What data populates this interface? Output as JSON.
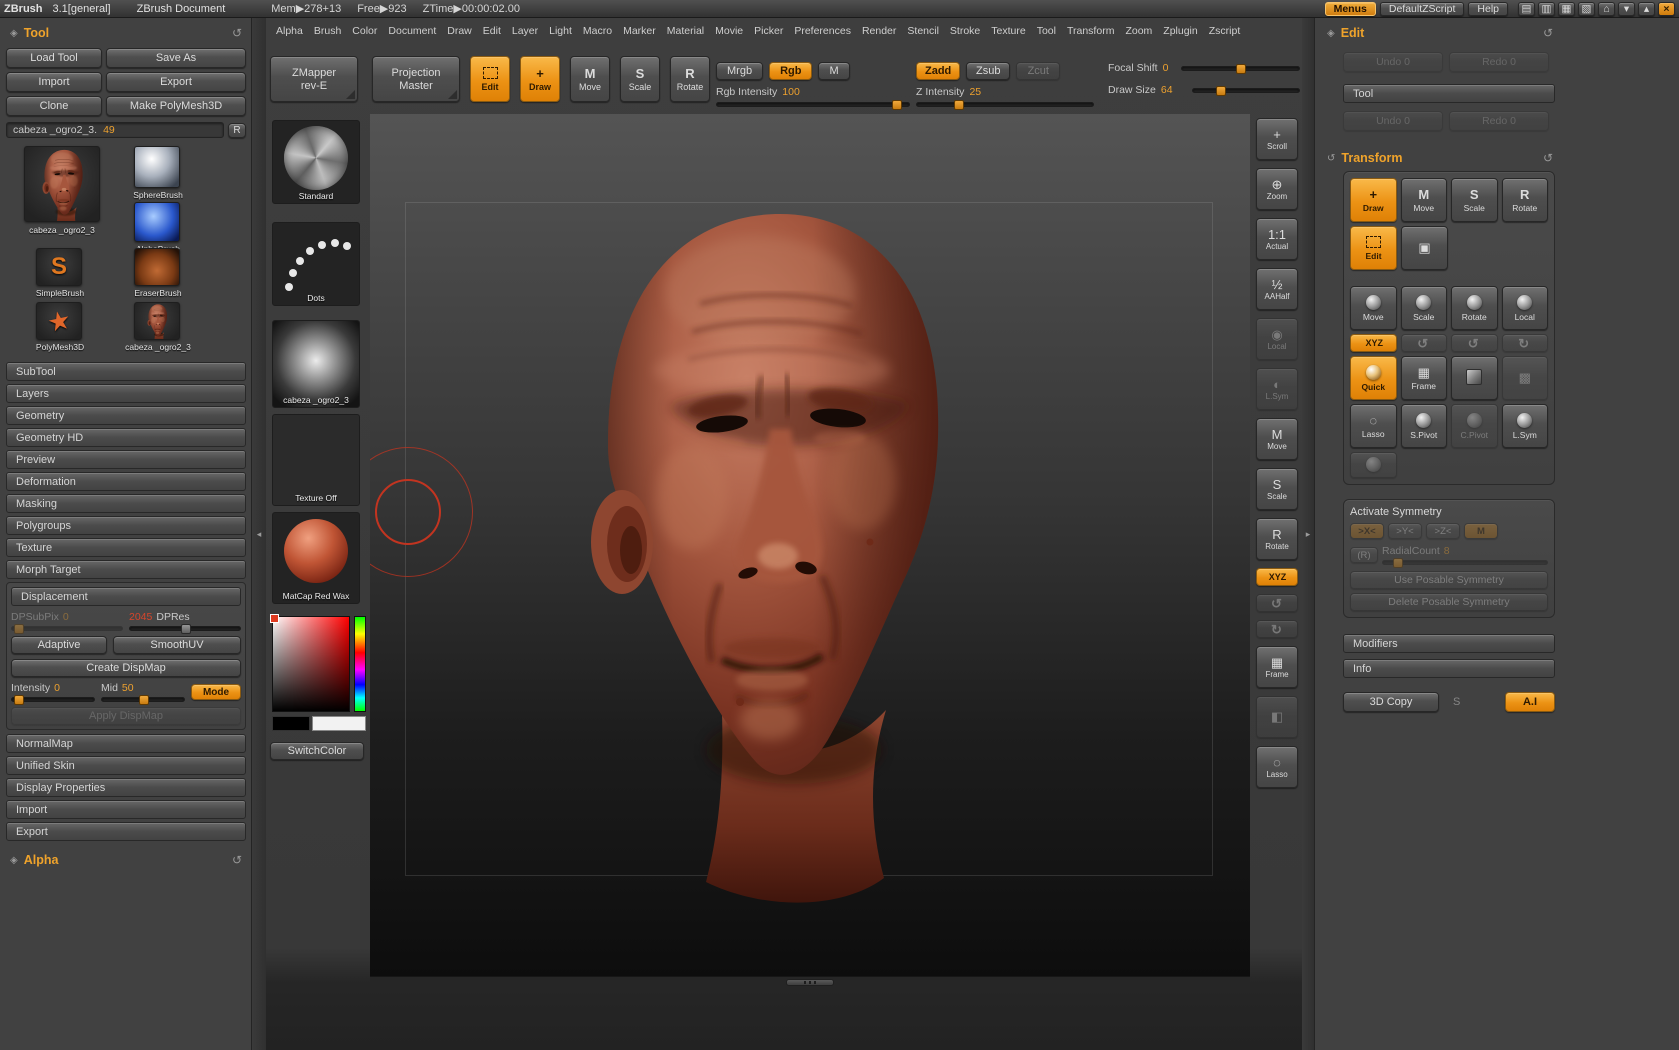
{
  "colors": {
    "accent_orange": "#ee9e2c",
    "cursor_red": "#c23420",
    "material_red": "#a2543d"
  },
  "titlebar": {
    "app_name": "ZBrush",
    "version": "3.1[general]",
    "document_title": "ZBrush Document",
    "stats": {
      "mem": "Mem▶278+13",
      "free": "Free▶923",
      "ztime": "ZTime▶00:00:02.00"
    },
    "menus_button": "Menus",
    "zscript_button": "DefaultZScript",
    "help_button": "Help",
    "window_icons": [
      {
        "icon": "knob-tray-icon",
        "glyph": "▤"
      },
      {
        "icon": "knob2-tray-icon",
        "glyph": "▥"
      },
      {
        "icon": "doc-grid-icon",
        "glyph": "▦"
      },
      {
        "icon": "doc-grid2-icon",
        "glyph": "▧"
      },
      {
        "icon": "home-icon",
        "glyph": "⌂"
      },
      {
        "icon": "minimize-icon",
        "glyph": "▾"
      },
      {
        "icon": "restore-icon",
        "glyph": "▴"
      },
      {
        "icon": "close-icon",
        "glyph": "×",
        "accent": true
      }
    ]
  },
  "menubar": {
    "items": [
      "Alpha",
      "Brush",
      "Color",
      "Document",
      "Draw",
      "Edit",
      "Layer",
      "Light",
      "Macro",
      "Marker",
      "Material",
      "Movie",
      "Picker",
      "Preferences",
      "Render",
      "Stencil",
      "Stroke",
      "Texture",
      "Tool",
      "Transform",
      "Zoom",
      "Zplugin",
      "Zscript"
    ]
  },
  "tool_panel": {
    "title": "Tool",
    "action_buttons": [
      {
        "label": "Load Tool"
      },
      {
        "label": "Save As"
      },
      {
        "label": "Import"
      },
      {
        "label": "Export"
      },
      {
        "label": "Clone"
      },
      {
        "label": "Make PolyMesh3D"
      }
    ],
    "current_tool": {
      "name": "cabeza _ogro2_3.",
      "index": "49",
      "r_button": "R"
    },
    "thumbnails": [
      {
        "label": "cabeza _ogro2_3",
        "kind": "head-large"
      },
      {
        "label": "SphereBrush",
        "kind": "sphere"
      },
      {
        "label": "AlphaBrush",
        "kind": "alpha-brush"
      },
      {
        "label": "SimpleBrush",
        "kind": "simple-brush"
      },
      {
        "label": "EraserBrush",
        "kind": "eraser-brush"
      },
      {
        "label": "PolyMesh3D",
        "kind": "polymesh-star"
      },
      {
        "label": "cabeza _ogro2_3",
        "kind": "head-small"
      }
    ],
    "sections_top": [
      "SubTool",
      "Layers",
      "Geometry",
      "Geometry HD",
      "Preview",
      "Deformation",
      "Masking",
      "Polygroups",
      "Texture",
      "Morph Target"
    ],
    "displacement": {
      "title": "Displacement",
      "dpsubpix": {
        "label": "DPSubPix",
        "value": "0",
        "handle_style": "left:2%"
      },
      "dpres": {
        "value": "2045",
        "label": "DPRes",
        "handle_style": "left:46%"
      },
      "adaptive_button": "Adaptive",
      "smoothuv_button": "SmoothUV",
      "create_dispmap_button": "Create DispMap",
      "intensity": {
        "label": "Intensity",
        "value": "0",
        "handle_style": "left:2%"
      },
      "mid": {
        "label": "Mid",
        "value": "50",
        "handle_style": "left:45%"
      },
      "mode_button": "Mode",
      "apply_dispmap_button": "Apply DispMap"
    },
    "sections_bottom": [
      "NormalMap",
      "Unified Skin",
      "Display Properties",
      "Import",
      "Export"
    ],
    "alpha_title": "Alpha"
  },
  "toolbar": {
    "zmapper_button": {
      "line1": "ZMapper",
      "line2": "rev-E"
    },
    "projection_master_button": {
      "line1": "Projection",
      "line2": "Master"
    },
    "edit_modes": [
      {
        "label": "Edit",
        "kind": "edit",
        "icon": "edit-frame-icon",
        "active": true
      },
      {
        "label": "Draw",
        "glyph": "+",
        "icon": "draw-crosshair-icon",
        "active": true
      },
      {
        "label": "Move",
        "glyph": "M",
        "icon": "move-icon"
      },
      {
        "label": "Scale",
        "glyph": "S",
        "icon": "scale-icon"
      },
      {
        "label": "Rotate",
        "glyph": "R",
        "icon": "rotate-icon"
      }
    ],
    "color_modes": [
      {
        "label": "Mrgb"
      },
      {
        "label": "Rgb",
        "active": true
      },
      {
        "label": "M"
      }
    ],
    "rgb_intensity": {
      "label": "Rgb Intensity",
      "value": "100",
      "handle_style": "left:91%"
    },
    "depth_modes": [
      {
        "label": "Zadd",
        "active": true
      },
      {
        "label": "Zsub"
      },
      {
        "label": "Zcut",
        "dim": true
      }
    ],
    "z_intensity": {
      "label": "Z Intensity",
      "value": "25",
      "handle_style": "left:21%"
    },
    "focal_shift": {
      "label": "Focal Shift",
      "value": "0",
      "handle_style": "left:46%"
    },
    "draw_size": {
      "label": "Draw Size",
      "value": "64",
      "handle_style": "left:22%"
    }
  },
  "brush_palette": {
    "brush": {
      "label": "Standard"
    },
    "stroke": {
      "label": "Dots"
    },
    "alpha": {
      "label": "cabeza _ogro2_3"
    },
    "texture": {
      "label": "Texture Off"
    },
    "material": {
      "label": "MatCap Red Wax"
    },
    "switch_color_button": "SwitchColor"
  },
  "right_shelf": {
    "items": [
      {
        "label": "Scroll",
        "icon": "scroll-icon",
        "glyph": "+"
      },
      {
        "label": "Zoom",
        "icon": "zoom-icon",
        "glyph": "⊕"
      },
      {
        "label": "Actual",
        "icon": "actual-size-icon",
        "glyph": "1:1"
      },
      {
        "label": "AAHalf",
        "icon": "aa-half-icon",
        "glyph": "½"
      },
      {
        "label": "Local",
        "icon": "local-pivot-icon",
        "glyph": "◉",
        "dim": true
      },
      {
        "label": "L.Sym",
        "icon": "local-symmetry-icon",
        "glyph": "◐",
        "dim": true
      },
      {
        "label": "Move",
        "icon": "move-icon",
        "glyph": "M"
      },
      {
        "label": "Scale",
        "icon": "scale-icon",
        "glyph": "S"
      },
      {
        "label": "Rotate",
        "icon": "rotate-icon",
        "glyph": "R"
      },
      {
        "label": "XYZ",
        "icon": "xyz-axis-icon",
        "active": true,
        "small": true
      },
      {
        "label": "",
        "icon": "spin-ccw-icon",
        "glyph": "↺",
        "dim": true,
        "small": true
      },
      {
        "label": "",
        "icon": "spin-cw-icon",
        "glyph": "↻",
        "dim": true,
        "small": true
      },
      {
        "label": "Frame",
        "icon": "frame-icon",
        "glyph": "▦"
      },
      {
        "label": "",
        "icon": "paint-icon",
        "glyph": "◧",
        "dim": true
      },
      {
        "label": "Lasso",
        "icon": "lasso-icon",
        "glyph": "◌"
      }
    ]
  },
  "edit_panel": {
    "title": "Edit",
    "document_history": [
      {
        "label": "Undo 0",
        "dim": true
      },
      {
        "label": "Redo 0",
        "dim": true
      }
    ],
    "tool_section_title": "Tool",
    "tool_history": [
      {
        "label": "Undo 0",
        "dim": true
      },
      {
        "label": "Redo 0",
        "dim": true
      }
    ],
    "transform": {
      "title": "Transform",
      "row_modes": [
        {
          "label": "Draw",
          "glyph": "+",
          "icon": "draw-crosshair-icon",
          "active": true
        },
        {
          "label": "Move",
          "glyph": "M",
          "icon": "move-icon"
        },
        {
          "label": "Scale",
          "glyph": "S",
          "icon": "scale-icon"
        },
        {
          "label": "Rotate",
          "glyph": "R",
          "icon": "rotate-icon"
        }
      ],
      "row_edit": [
        {
          "label": "Edit",
          "kind": "edit",
          "icon": "edit-frame-icon",
          "active": true
        },
        {
          "label": "",
          "glyph": "▣",
          "icon": "snapshot-icon"
        }
      ],
      "row_gizmo": [
        {
          "label": "Move",
          "kind": "ball",
          "icon": "move-gizmo-icon"
        },
        {
          "label": "Scale",
          "kind": "ball",
          "icon": "scale-gizmo-icon"
        },
        {
          "label": "Rotate",
          "kind": "ball",
          "icon": "rotate-gizmo-icon"
        },
        {
          "label": "Local",
          "kind": "ball",
          "icon": "local-gizmo-icon"
        }
      ],
      "row_axis": [
        {
          "label": "XYZ",
          "active": true,
          "small": true,
          "icon": "xyz-axis-icon"
        },
        {
          "label": "",
          "glyph": "↺",
          "dim": true,
          "small": true,
          "icon": "rotate-x-icon"
        },
        {
          "label": "",
          "glyph": "↺",
          "dim": true,
          "small": true,
          "icon": "rotate-y-icon"
        },
        {
          "label": "",
          "glyph": "↻",
          "dim": true,
          "small": true,
          "icon": "rotate-z-icon"
        }
      ],
      "row_quick": [
        {
          "label": "Quick",
          "kind": "ball",
          "icon": "quick-edit-icon",
          "active": true
        },
        {
          "label": "Frame",
          "glyph": "▦",
          "icon": "frame-icon"
        },
        {
          "label": "",
          "kind": "cube",
          "icon": "cube-icon"
        },
        {
          "label": "",
          "glyph": "▩",
          "icon": "point-select-icon",
          "dim": true
        }
      ],
      "row_pivot": [
        {
          "label": "Lasso",
          "glyph": "◌",
          "icon": "lasso-icon"
        },
        {
          "label": "S.Pivot",
          "kind": "ball",
          "icon": "set-pivot-icon"
        },
        {
          "label": "C.Pivot",
          "kind": "ball",
          "icon": "clear-pivot-icon",
          "dim": true
        },
        {
          "label": "L.Sym",
          "kind": "ball",
          "icon": "local-symmetry-icon"
        }
      ],
      "row_extra": [
        {
          "label": "",
          "kind": "ball",
          "icon": "unlabeled-icon",
          "dim": true
        }
      ]
    },
    "symmetry": {
      "title": "Activate Symmetry",
      "axis_buttons": [
        {
          "label": ">X<",
          "dim": true,
          "accent": true
        },
        {
          "label": ">Y<",
          "dim": true
        },
        {
          "label": ">Z<",
          "dim": true
        },
        {
          "label": "M",
          "dim": true,
          "accent": true
        }
      ],
      "r_button": "(R)",
      "radial_count": {
        "label": "RadialCount",
        "value": "8",
        "handle_style": "left:6%"
      },
      "use_posable_button": "Use Posable Symmetry",
      "delete_posable_button": "Delete Posable Symmetry"
    },
    "modifiers_section_title": "Modifiers",
    "info_section_title": "Info",
    "info_row": {
      "copy_button": "3D Copy",
      "s_label": "S",
      "ai_button": "A.I"
    }
  }
}
